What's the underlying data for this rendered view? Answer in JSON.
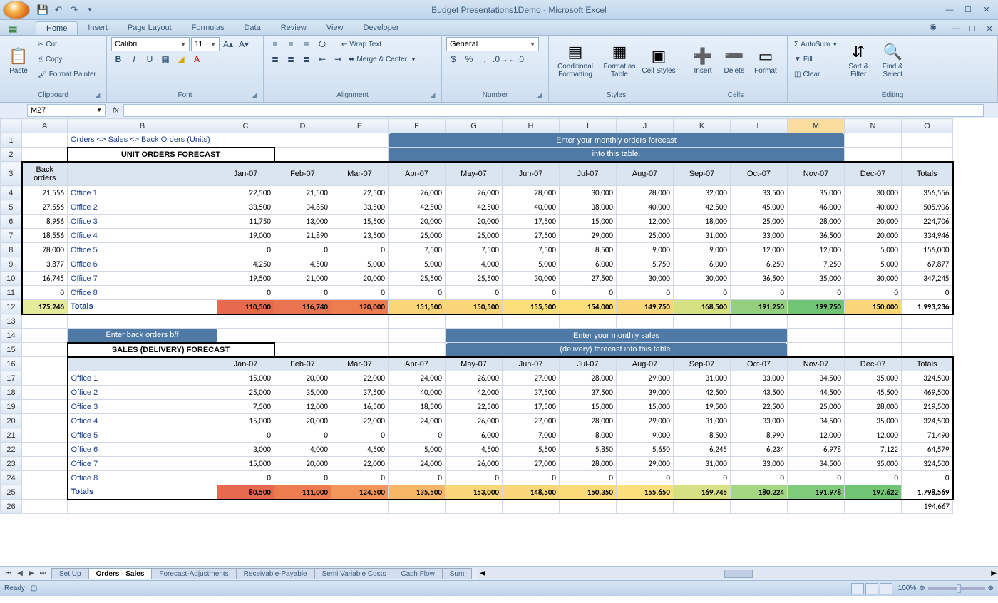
{
  "app": {
    "title": "Budget Presentations1Demo - Microsoft Excel",
    "qat": [
      "save",
      "undo",
      "redo"
    ]
  },
  "chart_data": {
    "type": "table",
    "note": "Two forecast tables with monthly values and totals; a colour gradient is applied to the Totals rows (red=low → green=high)."
  },
  "ribbon": {
    "tabs": [
      "Home",
      "Insert",
      "Page Layout",
      "Formulas",
      "Data",
      "Review",
      "View",
      "Developer"
    ],
    "active": "Home",
    "clipboard": {
      "paste": "Paste",
      "cut": "Cut",
      "copy": "Copy",
      "fp": "Format Painter",
      "group": "Clipboard"
    },
    "font": {
      "name": "Calibri",
      "size": "11",
      "group": "Font"
    },
    "alignment": {
      "wrap": "Wrap Text",
      "merge": "Merge & Center",
      "group": "Alignment"
    },
    "number": {
      "format": "General",
      "group": "Number"
    },
    "styles": {
      "cond": "Conditional Formatting",
      "table": "Format as Table",
      "cell": "Cell Styles",
      "group": "Styles"
    },
    "cells": {
      "insert": "Insert",
      "delete": "Delete",
      "format": "Format",
      "group": "Cells"
    },
    "editing": {
      "autosum": "AutoSum",
      "fill": "Fill",
      "clear": "Clear",
      "sort": "Sort & Filter",
      "find": "Find & Select",
      "group": "Editing"
    }
  },
  "namebox": "M27",
  "columns": [
    "A",
    "B",
    "C",
    "D",
    "E",
    "F",
    "G",
    "H",
    "I",
    "J",
    "K",
    "L",
    "M",
    "N",
    "O"
  ],
  "sheet": {
    "breadcrumb": "Orders <> Sales <> Back Orders (Units)",
    "section1": "UNIT ORDERS FORECAST",
    "callout1a": "Enter your monthly orders forecast",
    "callout1b": "into this table.",
    "backorders_hdr": "Back orders",
    "months": [
      "Jan-07",
      "Feb-07",
      "Mar-07",
      "Apr-07",
      "May-07",
      "Jun-07",
      "Jul-07",
      "Aug-07",
      "Sep-07",
      "Oct-07",
      "Nov-07",
      "Dec-07"
    ],
    "totals_hdr": "Totals",
    "orders": [
      {
        "bo": "21,556",
        "name": "Office 1",
        "v": [
          "22,500",
          "21,500",
          "22,500",
          "26,000",
          "26,000",
          "28,000",
          "30,000",
          "28,000",
          "32,000",
          "33,500",
          "35,000",
          "30,000"
        ],
        "tot": "356,556"
      },
      {
        "bo": "27,556",
        "name": "Office 2",
        "v": [
          "33,500",
          "34,850",
          "33,500",
          "42,500",
          "42,500",
          "40,000",
          "38,000",
          "40,000",
          "42,500",
          "45,000",
          "46,000",
          "40,000"
        ],
        "tot": "505,906"
      },
      {
        "bo": "8,956",
        "name": "Office 3",
        "v": [
          "11,750",
          "13,000",
          "15,500",
          "20,000",
          "20,000",
          "17,500",
          "15,000",
          "12,000",
          "18,000",
          "25,000",
          "28,000",
          "20,000"
        ],
        "tot": "224,706"
      },
      {
        "bo": "18,556",
        "name": "Office 4",
        "v": [
          "19,000",
          "21,890",
          "23,500",
          "25,000",
          "25,000",
          "27,500",
          "29,000",
          "25,000",
          "31,000",
          "33,000",
          "36,500",
          "20,000"
        ],
        "tot": "334,946"
      },
      {
        "bo": "78,000",
        "name": "Office 5",
        "v": [
          "0",
          "0",
          "0",
          "7,500",
          "7,500",
          "7,500",
          "8,500",
          "9,000",
          "9,000",
          "12,000",
          "12,000",
          "5,000"
        ],
        "tot": "156,000"
      },
      {
        "bo": "3,877",
        "name": "Office 6",
        "v": [
          "4,250",
          "4,500",
          "5,000",
          "5,000",
          "4,000",
          "5,000",
          "6,000",
          "5,750",
          "6,000",
          "6,250",
          "7,250",
          "5,000"
        ],
        "tot": "67,877"
      },
      {
        "bo": "16,745",
        "name": "Office 7",
        "v": [
          "19,500",
          "21,000",
          "20,000",
          "25,500",
          "25,500",
          "30,000",
          "27,500",
          "30,000",
          "30,000",
          "36,500",
          "35,000",
          "30,000"
        ],
        "tot": "347,245"
      },
      {
        "bo": "0",
        "name": "Office 8",
        "v": [
          "0",
          "0",
          "0",
          "0",
          "0",
          "0",
          "0",
          "0",
          "0",
          "0",
          "0",
          "0"
        ],
        "tot": "0"
      }
    ],
    "orders_total": {
      "bo": "175,246",
      "name": "Totals",
      "v": [
        "110,500",
        "116,740",
        "120,000",
        "151,500",
        "150,500",
        "155,500",
        "154,000",
        "149,750",
        "168,500",
        "191,250",
        "199,750",
        "150,000"
      ],
      "tot": "1,993,236"
    },
    "callout_bo": "Enter back orders b/f",
    "callout2a": "Enter your monthly sales",
    "callout2b": "(delivery) forecast into this table.",
    "section2": "SALES (DELIVERY) FORECAST",
    "sales": [
      {
        "name": "Office 1",
        "v": [
          "15,000",
          "20,000",
          "22,000",
          "24,000",
          "26,000",
          "27,000",
          "28,000",
          "29,000",
          "31,000",
          "33,000",
          "34,500",
          "35,000"
        ],
        "tot": "324,500"
      },
      {
        "name": "Office 2",
        "v": [
          "25,000",
          "35,000",
          "37,500",
          "40,000",
          "42,000",
          "37,500",
          "37,500",
          "39,000",
          "42,500",
          "43,500",
          "44,500",
          "45,500"
        ],
        "tot": "469,500"
      },
      {
        "name": "Office 3",
        "v": [
          "7,500",
          "12,000",
          "16,500",
          "18,500",
          "22,500",
          "17,500",
          "15,000",
          "15,000",
          "19,500",
          "22,500",
          "25,000",
          "28,000"
        ],
        "tot": "219,500"
      },
      {
        "name": "Office 4",
        "v": [
          "15,000",
          "20,000",
          "22,000",
          "24,000",
          "26,000",
          "27,000",
          "28,000",
          "29,000",
          "31,000",
          "33,000",
          "34,500",
          "35,000"
        ],
        "tot": "324,500"
      },
      {
        "name": "Office 5",
        "v": [
          "0",
          "0",
          "0",
          "0",
          "6,000",
          "7,000",
          "8,000",
          "9,000",
          "8,500",
          "8,990",
          "12,000",
          "12,000"
        ],
        "tot": "71,490"
      },
      {
        "name": "Office 6",
        "v": [
          "3,000",
          "4,000",
          "4,500",
          "5,000",
          "4,500",
          "5,500",
          "5,850",
          "5,650",
          "6,245",
          "6,234",
          "6,978",
          "7,122"
        ],
        "tot": "64,579"
      },
      {
        "name": "Office 7",
        "v": [
          "15,000",
          "20,000",
          "22,000",
          "24,000",
          "26,000",
          "27,000",
          "28,000",
          "29,000",
          "31,000",
          "33,000",
          "34,500",
          "35,000"
        ],
        "tot": "324,500"
      },
      {
        "name": "Office 8",
        "v": [
          "0",
          "0",
          "0",
          "0",
          "0",
          "0",
          "0",
          "0",
          "0",
          "0",
          "0",
          "0"
        ],
        "tot": "0"
      }
    ],
    "sales_total": {
      "name": "Totals",
      "v": [
        "80,500",
        "111,000",
        "124,500",
        "135,500",
        "153,000",
        "148,500",
        "150,350",
        "155,650",
        "169,745",
        "180,224",
        "191,978",
        "197,622"
      ],
      "tot": "1,798,569"
    },
    "trailing": "194,667"
  },
  "heatmap_orders": [
    "#e86a4e",
    "#ea7450",
    "#ed7d4f",
    "#f9d778",
    "#f9d778",
    "#fbdf7a",
    "#fbdf7a",
    "#f9d778",
    "#d6e184",
    "#93cf7e",
    "#6fc573",
    "#f9d778"
  ],
  "heatmap_sales": [
    "#e86a4e",
    "#ed7d4f",
    "#f2965a",
    "#f7b767",
    "#f9d778",
    "#f9d778",
    "#fadb78",
    "#fbdf7a",
    "#d6e184",
    "#a5d681",
    "#7ecb78",
    "#6fc573"
  ],
  "tabs": [
    "Set Up",
    "Orders - Sales",
    "Forecast-Adjustments",
    "Receivable-Payable",
    "Semi Variable Costs",
    "Cash Flow",
    "Sum"
  ],
  "active_tab": "Orders - Sales",
  "status": {
    "ready": "Ready",
    "zoom": "100%"
  }
}
